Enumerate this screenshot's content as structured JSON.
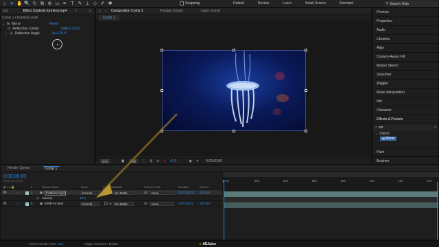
{
  "toolbar": {
    "tools": [
      {
        "icon": "home-icon",
        "glyph": "⌂"
      },
      {
        "icon": "selection-arrow-icon",
        "glyph": "➤"
      },
      {
        "icon": "hand-icon",
        "glyph": "✋"
      },
      {
        "icon": "zoom-icon",
        "glyph": "🔍"
      },
      {
        "icon": "rotate-icon",
        "glyph": "↻"
      },
      {
        "icon": "camera-icon",
        "glyph": "⧉"
      },
      {
        "icon": "pan-behind-icon",
        "glyph": "⊕"
      },
      {
        "icon": "rectangle-icon",
        "glyph": "▭"
      },
      {
        "icon": "pen-icon",
        "glyph": "✒"
      },
      {
        "icon": "type-icon",
        "glyph": "T"
      },
      {
        "icon": "brush-icon",
        "glyph": "✎"
      },
      {
        "icon": "stamp-icon",
        "glyph": "⊥"
      },
      {
        "icon": "eraser-icon",
        "glyph": "◇"
      },
      {
        "icon": "roto-icon",
        "glyph": "✐"
      },
      {
        "icon": "puppet-icon",
        "glyph": "✱"
      }
    ],
    "snapping_label": "Snapping",
    "workspaces": [
      "Default",
      "Review",
      "Learn",
      "Small Screen",
      "Standard"
    ],
    "search_placeholder": "Search Help"
  },
  "effect_controls": {
    "tabs": [
      "ect",
      "Effect Controls formirror.mp4"
    ],
    "layer_path": "Comp 1 • formirror.mp4",
    "effect_name": "Mirror",
    "reset_label": "Reset",
    "props": [
      {
        "label": "Reflection Center",
        "value": "1248.0,333.0"
      },
      {
        "label": "Reflection Angle",
        "value": "0x+270.0°"
      }
    ]
  },
  "composition": {
    "tabs": [
      "Composition Comp 1",
      "Footage (none)",
      "Layer (none)"
    ],
    "sub_tab": "Comp 1",
    "zoom": "50%",
    "resolution": "Half",
    "exposure": "+0.0",
    "timecode": "0;00;00;00"
  },
  "right_panel": {
    "items": [
      "Preview",
      "Properties",
      "Audio",
      "Libraries",
      "Align",
      "Content-Aware Fill",
      "Motion Sketch",
      "Smoother",
      "Wiggler",
      "Mask Interpolation",
      "Info",
      "Character"
    ],
    "effects_presets": {
      "title": "Effects & Presets",
      "search_value": "mir",
      "category": "Distort",
      "result": "Mirror"
    },
    "bottom_items": [
      "Paint",
      "Brushes"
    ]
  },
  "timeline": {
    "tabs": [
      "Render Queue",
      "Comp 1"
    ],
    "timecode": "0;00;00;00",
    "fps": "00000 (29.97 fps)",
    "col_headers": {
      "source": "Source Name",
      "mode": "Mode",
      "t": "T",
      "trkmat": "Track Matte",
      "parent": "Parent & Link",
      "duration": "Duration",
      "stretch": "Stretch"
    },
    "layers": [
      {
        "num": "1",
        "name": "forMirror.mp4",
        "mode": "Normal",
        "matte": "No Matte",
        "parent": "None",
        "duration": "0;00;15;01",
        "stretch": "100.0%",
        "color": "#8fc8c8",
        "selected": true
      },
      {
        "num": "2",
        "name": "forMirror.mp4",
        "mode": "Normal",
        "matte": "No Matte",
        "parent": "None",
        "duration": "0;00;15;01",
        "stretch": "100.0%",
        "color": "#8fc8c8",
        "selected": false
      }
    ],
    "opacity_row": {
      "label": "Opacity",
      "value": "40%"
    },
    "ruler": [
      "0s",
      "02s",
      "04s",
      "06s",
      "08s",
      "10s",
      "12s",
      "14s"
    ]
  },
  "status": {
    "frame_render_label": "Frame Render Time",
    "frame_render_value": "3ms",
    "toggle_label": "Toggle Switches / Modes",
    "watermark": "AEJuice"
  },
  "colors": {
    "accent": "#2d8ceb",
    "panel_bg": "#1e1e1e",
    "layer_bar": "#5c7c7a",
    "playhead": "#2d8ceb"
  }
}
